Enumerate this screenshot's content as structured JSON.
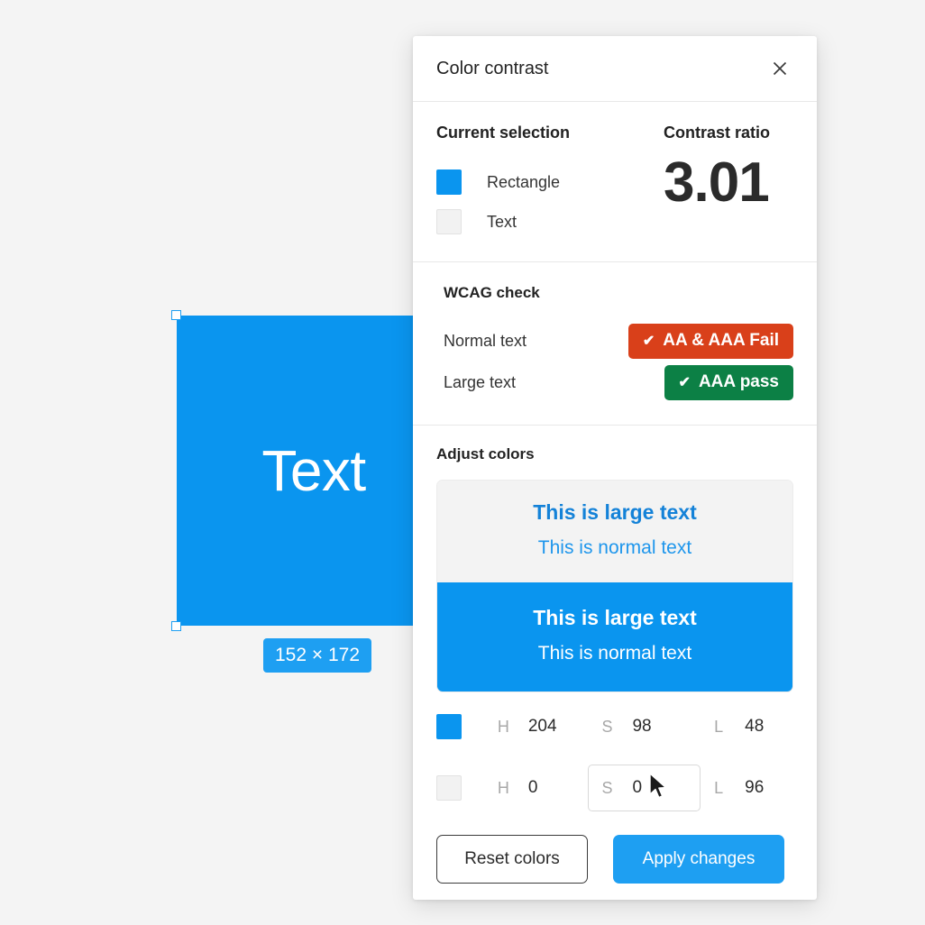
{
  "canvas": {
    "shape_label": "Text",
    "size_badge": "152 × 172",
    "shape_color": "#0a95ef",
    "selection_accent": "#1e9ff2",
    "background": "#f4f4f4"
  },
  "panel": {
    "title": "Color contrast",
    "close_icon": "close-icon",
    "selection": {
      "heading": "Current selection",
      "items": [
        {
          "label": "Rectangle",
          "swatch_color": "#0a95ef"
        },
        {
          "label": "Text",
          "swatch_color": "#f2f2f2"
        }
      ]
    },
    "contrast": {
      "heading": "Contrast ratio",
      "value": "3.01"
    },
    "wcag": {
      "heading": "WCAG check",
      "rows": [
        {
          "label": "Normal  text",
          "badge_text": "AA & AAA Fail",
          "badge_icon": "check-icon",
          "badge_color": "#d9401a",
          "status": "fail"
        },
        {
          "label": "Large text",
          "badge_text": "AAA pass",
          "badge_icon": "check-icon",
          "badge_color": "#0c8045",
          "status": "pass"
        }
      ]
    },
    "adjust": {
      "heading": "Adjust colors",
      "preview": {
        "light": {
          "large_text": "This is large text",
          "normal_text": "This is normal text",
          "background": "#f3f3f3",
          "text_color": "#1e96ec"
        },
        "dark": {
          "large_text": "This is large text",
          "normal_text": "This is normal text",
          "background": "#0a95ef",
          "text_color": "#ffffff"
        }
      },
      "color_rows": [
        {
          "swatch_color": "#0a95ef",
          "h_label": "H",
          "h_value": "204",
          "s_label": "S",
          "s_value": "98",
          "l_label": "L",
          "l_value": "48",
          "focused_field": ""
        },
        {
          "swatch_color": "#f2f2f2",
          "h_label": "H",
          "h_value": "0",
          "s_label": "S",
          "s_value": "0",
          "l_label": "L",
          "l_value": "96",
          "focused_field": "s"
        }
      ]
    },
    "actions": {
      "reset_label": "Reset colors",
      "apply_label": "Apply changes",
      "apply_color": "#1e9ff2"
    }
  }
}
